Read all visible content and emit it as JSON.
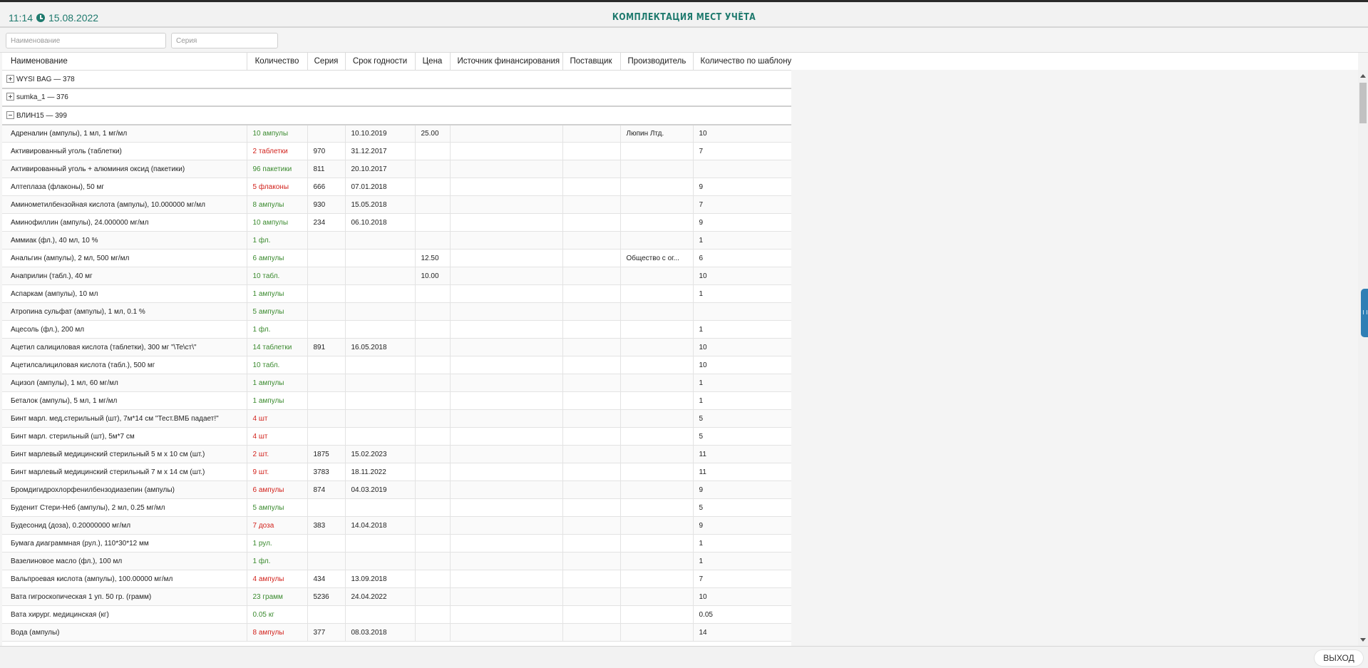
{
  "header": {
    "time": "11:14",
    "date": "15.08.2022",
    "title": "КОМПЛЕКТАЦИЯ МЕСТ УЧЁТА"
  },
  "filters": {
    "name_placeholder": "Наименование",
    "series_placeholder": "Серия"
  },
  "columns": [
    "Наименование",
    "Количество",
    "Серия",
    "Срок годности",
    "Цена",
    "Источник финансирования",
    "Поставщик",
    "Производитель",
    "Количество по шаблону"
  ],
  "groups": [
    {
      "label": "WYSI BAG — 378",
      "expanded": false
    },
    {
      "label": "sumka_1 — 376",
      "expanded": false
    },
    {
      "label": "ВЛИН15 — 399",
      "expanded": true
    }
  ],
  "rows": [
    {
      "name": "Адреналин (ампулы), 1 мл, 1 мг/мл",
      "qty": "10 ампулы",
      "qty_status": "ok",
      "series": "",
      "expiry": "10.10.2019",
      "price": "25.00",
      "source": "",
      "supplier": "",
      "manufacturer": "Люпин Лтд.",
      "template_qty": "10"
    },
    {
      "name": "Активированный уголь (таблетки)",
      "qty": "2 таблетки",
      "qty_status": "low",
      "series": "970",
      "expiry": "31.12.2017",
      "price": "",
      "source": "",
      "supplier": "",
      "manufacturer": "",
      "template_qty": "7"
    },
    {
      "name": "Активированный уголь + алюминия оксид (пакетики)",
      "qty": "96 пакетики",
      "qty_status": "ok",
      "series": "811",
      "expiry": "20.10.2017",
      "price": "",
      "source": "",
      "supplier": "",
      "manufacturer": "",
      "template_qty": ""
    },
    {
      "name": "Алтеплаза (флаконы), 50 мг",
      "qty": "5 флаконы",
      "qty_status": "low",
      "series": "666",
      "expiry": "07.01.2018",
      "price": "",
      "source": "",
      "supplier": "",
      "manufacturer": "",
      "template_qty": "9"
    },
    {
      "name": "Аминометилбензойная кислота (ампулы), 10.000000 мг/мл",
      "qty": "8 ампулы",
      "qty_status": "ok",
      "series": "930",
      "expiry": "15.05.2018",
      "price": "",
      "source": "",
      "supplier": "",
      "manufacturer": "",
      "template_qty": "7"
    },
    {
      "name": "Аминофиллин (ампулы), 24.000000 мг/мл",
      "qty": "10 ампулы",
      "qty_status": "ok",
      "series": "234",
      "expiry": "06.10.2018",
      "price": "",
      "source": "",
      "supplier": "",
      "manufacturer": "",
      "template_qty": "9"
    },
    {
      "name": "Аммиак (фл.), 40 мл, 10 %",
      "qty": "1 фл.",
      "qty_status": "ok",
      "series": "",
      "expiry": "",
      "price": "",
      "source": "",
      "supplier": "",
      "manufacturer": "",
      "template_qty": "1"
    },
    {
      "name": "Анальгин (ампулы), 2 мл, 500 мг/мл",
      "qty": "6 ампулы",
      "qty_status": "ok",
      "series": "",
      "expiry": "",
      "price": "12.50",
      "source": "",
      "supplier": "",
      "manufacturer": "Общество с ог...",
      "template_qty": "6"
    },
    {
      "name": "Анаприлин (табл.), 40 мг",
      "qty": "10 табл.",
      "qty_status": "ok",
      "series": "",
      "expiry": "",
      "price": "10.00",
      "source": "",
      "supplier": "",
      "manufacturer": "",
      "template_qty": "10"
    },
    {
      "name": "Аспаркам (ампулы), 10 мл",
      "qty": "1 ампулы",
      "qty_status": "ok",
      "series": "",
      "expiry": "",
      "price": "",
      "source": "",
      "supplier": "",
      "manufacturer": "",
      "template_qty": "1"
    },
    {
      "name": "Атропина сульфат (ампулы), 1 мл, 0.1 %",
      "qty": "5 ампулы",
      "qty_status": "ok",
      "series": "",
      "expiry": "",
      "price": "",
      "source": "",
      "supplier": "",
      "manufacturer": "",
      "template_qty": ""
    },
    {
      "name": "Ацесоль (фл.), 200 мл",
      "qty": "1 фл.",
      "qty_status": "ok",
      "series": "",
      "expiry": "",
      "price": "",
      "source": "",
      "supplier": "",
      "manufacturer": "",
      "template_qty": "1"
    },
    {
      "name": "Ацетил салициловая кислота (таблетки), 300 мг \"\\Te\\ст\\\"",
      "qty": "14 таблетки",
      "qty_status": "ok",
      "series": "891",
      "expiry": "16.05.2018",
      "price": "",
      "source": "",
      "supplier": "",
      "manufacturer": "",
      "template_qty": "10"
    },
    {
      "name": "Ацетилсалициловая кислота (табл.), 500 мг",
      "qty": "10 табл.",
      "qty_status": "ok",
      "series": "",
      "expiry": "",
      "price": "",
      "source": "",
      "supplier": "",
      "manufacturer": "",
      "template_qty": "10"
    },
    {
      "name": "Ацизол (ампулы), 1 мл, 60 мг/мл",
      "qty": "1 ампулы",
      "qty_status": "ok",
      "series": "",
      "expiry": "",
      "price": "",
      "source": "",
      "supplier": "",
      "manufacturer": "",
      "template_qty": "1"
    },
    {
      "name": "Беталок (ампулы), 5 мл, 1 мг/мл",
      "qty": "1 ампулы",
      "qty_status": "ok",
      "series": "",
      "expiry": "",
      "price": "",
      "source": "",
      "supplier": "",
      "manufacturer": "",
      "template_qty": "1"
    },
    {
      "name": "Бинт марл. мед.стерильный (шт), 7м*14 см \"Тест.ВМБ падает!\"",
      "qty": "4 шт",
      "qty_status": "low",
      "series": "",
      "expiry": "",
      "price": "",
      "source": "",
      "supplier": "",
      "manufacturer": "",
      "template_qty": "5"
    },
    {
      "name": "Бинт марл. стерильный (шт), 5м*7 см",
      "qty": "4 шт",
      "qty_status": "low",
      "series": "",
      "expiry": "",
      "price": "",
      "source": "",
      "supplier": "",
      "manufacturer": "",
      "template_qty": "5"
    },
    {
      "name": "Бинт марлевый медицинский стерильный 5 м х 10 см (шт.)",
      "qty": "2 шт.",
      "qty_status": "low",
      "series": "1875",
      "expiry": "15.02.2023",
      "price": "",
      "source": "",
      "supplier": "",
      "manufacturer": "",
      "template_qty": "11"
    },
    {
      "name": "Бинт марлевый медицинский стерильный 7 м х 14 см (шт.)",
      "qty": "9 шт.",
      "qty_status": "low",
      "series": "3783",
      "expiry": "18.11.2022",
      "price": "",
      "source": "",
      "supplier": "",
      "manufacturer": "",
      "template_qty": "11"
    },
    {
      "name": "Бромдигидрохлорфенилбензодиазепин (ампулы)",
      "qty": "6 ампулы",
      "qty_status": "low",
      "series": "874",
      "expiry": "04.03.2019",
      "price": "",
      "source": "",
      "supplier": "",
      "manufacturer": "",
      "template_qty": "9"
    },
    {
      "name": "Буденит Стери-Неб (ампулы), 2 мл, 0.25 мг/мл",
      "qty": "5 ампулы",
      "qty_status": "ok",
      "series": "",
      "expiry": "",
      "price": "",
      "source": "",
      "supplier": "",
      "manufacturer": "",
      "template_qty": "5"
    },
    {
      "name": "Будесонид (доза), 0.20000000 мг/мл",
      "qty": "7 доза",
      "qty_status": "low",
      "series": "383",
      "expiry": "14.04.2018",
      "price": "",
      "source": "",
      "supplier": "",
      "manufacturer": "",
      "template_qty": "9"
    },
    {
      "name": "Бумага диаграммная (рул.), 110*30*12 мм",
      "qty": "1 рул.",
      "qty_status": "ok",
      "series": "",
      "expiry": "",
      "price": "",
      "source": "",
      "supplier": "",
      "manufacturer": "",
      "template_qty": "1"
    },
    {
      "name": "Вазелиновое масло (фл.), 100 мл",
      "qty": "1 фл.",
      "qty_status": "ok",
      "series": "",
      "expiry": "",
      "price": "",
      "source": "",
      "supplier": "",
      "manufacturer": "",
      "template_qty": "1"
    },
    {
      "name": "Вальпроевая кислота (ампулы), 100.00000 мг/мл",
      "qty": "4 ампулы",
      "qty_status": "low",
      "series": "434",
      "expiry": "13.09.2018",
      "price": "",
      "source": "",
      "supplier": "",
      "manufacturer": "",
      "template_qty": "7"
    },
    {
      "name": "Вата гигроскопическая 1 уп. 50 гр. (грамм)",
      "qty": "23 грамм",
      "qty_status": "ok",
      "series": "5236",
      "expiry": "24.04.2022",
      "price": "",
      "source": "",
      "supplier": "",
      "manufacturer": "",
      "template_qty": "10"
    },
    {
      "name": "Вата хирург. медицинская (кг)",
      "qty": "0.05 кг",
      "qty_status": "ok",
      "series": "",
      "expiry": "",
      "price": "",
      "source": "",
      "supplier": "",
      "manufacturer": "",
      "template_qty": "0.05"
    },
    {
      "name": "Вода (ампулы)",
      "qty": "8 ампулы",
      "qty_status": "low",
      "series": "377",
      "expiry": "08.03.2018",
      "price": "",
      "source": "",
      "supplier": "",
      "manufacturer": "",
      "template_qty": "14"
    }
  ],
  "colors": {
    "accent": "#1f7a6e",
    "qty_ok": "#3a8a2e",
    "qty_low": "#d2221c",
    "side_tab": "#2f7fb5"
  },
  "icons": {
    "clock": "clock-icon",
    "expand": "plus-square-icon",
    "collapse": "minus-square-icon"
  },
  "footer": {
    "exit_label": "ВЫХОД"
  }
}
